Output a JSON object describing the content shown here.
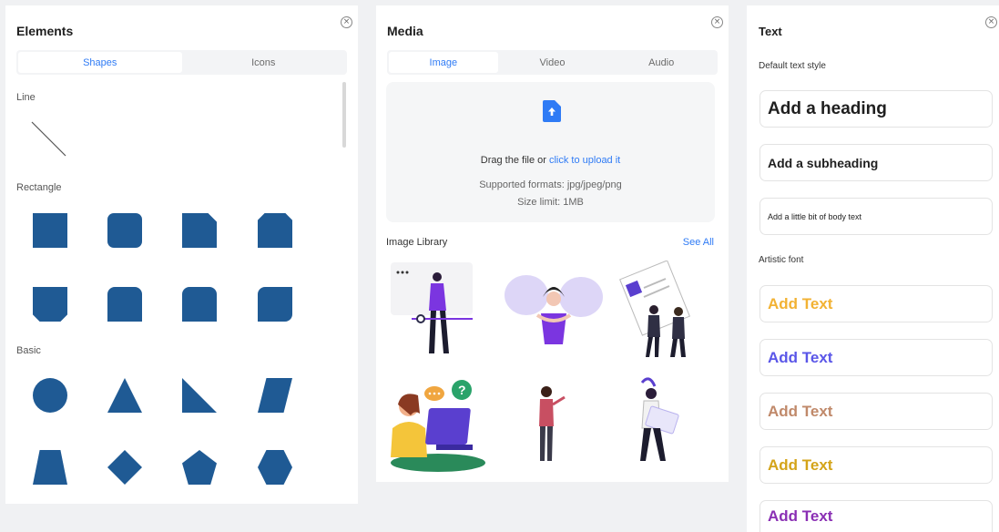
{
  "elements": {
    "title": "Elements",
    "tabs": [
      "Shapes",
      "Icons"
    ],
    "sections": {
      "line": "Line",
      "rectangle": "Rectangle",
      "basic": "Basic"
    },
    "shape_color": "#1f5a94"
  },
  "media": {
    "title": "Media",
    "tabs": [
      "Image",
      "Video",
      "Audio"
    ],
    "upload": {
      "text": "Drag the file or ",
      "link": "click to upload it",
      "formats": "Supported formats: jpg/jpeg/png",
      "limit": "Size limit: 1MB"
    },
    "library_label": "Image Library",
    "see_all": "See All"
  },
  "text": {
    "title": "Text",
    "default_label": "Default text style",
    "heading": "Add a heading",
    "subheading": "Add a subheading",
    "body": "Add a little bit of body text",
    "artistic_label": "Artistic font",
    "artistic": [
      {
        "label": "Add Text",
        "color": "#f2b233"
      },
      {
        "label": "Add Text",
        "color": "#5a56e8"
      },
      {
        "label": "Add Text",
        "color": "#c0896a"
      },
      {
        "label": "Add Text",
        "color": "#d4a419"
      },
      {
        "label": "Add Text",
        "color": "#8a2fb4"
      }
    ]
  }
}
